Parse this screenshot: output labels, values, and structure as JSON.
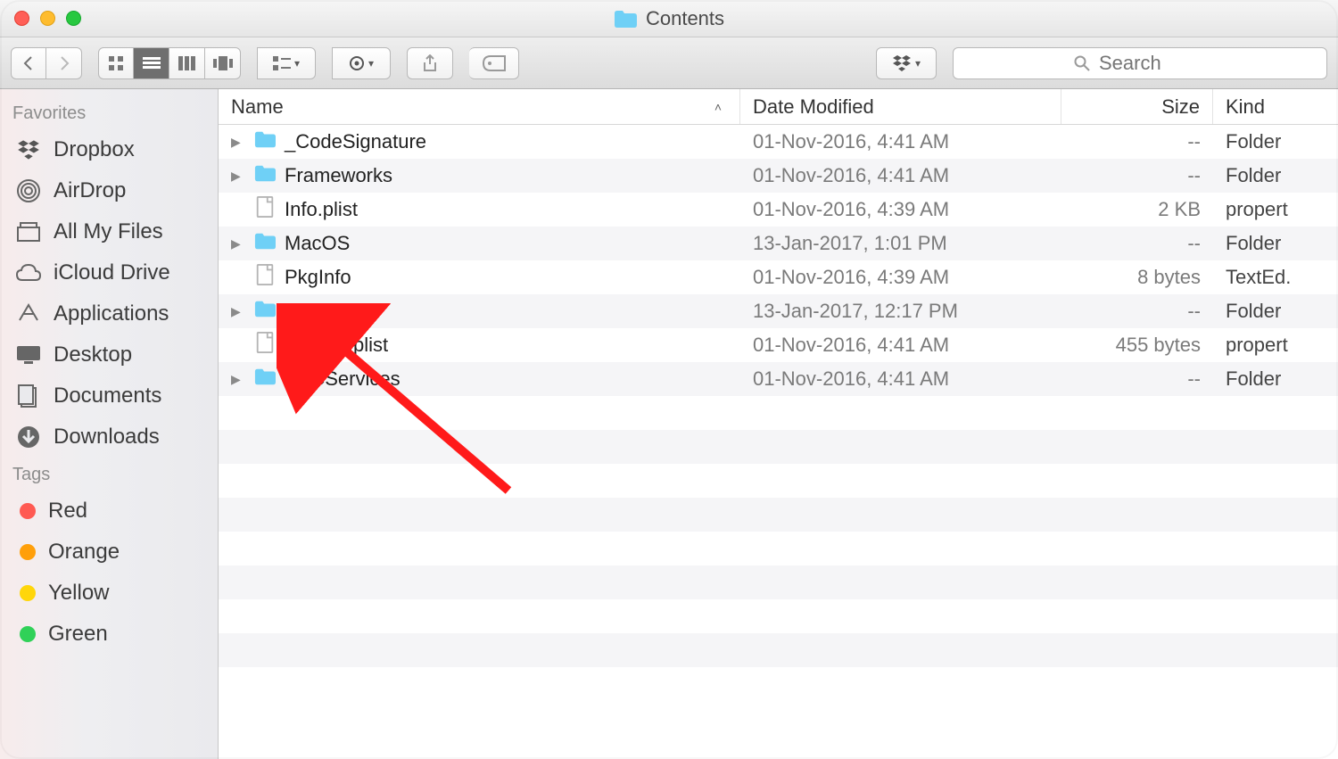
{
  "window": {
    "title": "Contents"
  },
  "toolbar": {
    "search_placeholder": "Search"
  },
  "sidebar": {
    "sections": {
      "favorites_label": "Favorites",
      "tags_label": "Tags"
    },
    "favorites": [
      {
        "label": "Dropbox",
        "icon": "dropbox-icon"
      },
      {
        "label": "AirDrop",
        "icon": "airdrop-icon"
      },
      {
        "label": "All My Files",
        "icon": "all-my-files-icon"
      },
      {
        "label": "iCloud Drive",
        "icon": "icloud-icon"
      },
      {
        "label": "Applications",
        "icon": "applications-icon"
      },
      {
        "label": "Desktop",
        "icon": "desktop-icon"
      },
      {
        "label": "Documents",
        "icon": "documents-icon"
      },
      {
        "label": "Downloads",
        "icon": "downloads-icon"
      }
    ],
    "tags": [
      {
        "label": "Red",
        "color": "#ff5a52"
      },
      {
        "label": "Orange",
        "color": "#ff9f0a"
      },
      {
        "label": "Yellow",
        "color": "#ffd60a"
      },
      {
        "label": "Green",
        "color": "#30d158"
      }
    ]
  },
  "columns": {
    "name": "Name",
    "date": "Date Modified",
    "size": "Size",
    "kind": "Kind"
  },
  "files": [
    {
      "name": "_CodeSignature",
      "type": "folder",
      "expandable": true,
      "date": "01-Nov-2016, 4:41 AM",
      "size": "--",
      "kind": "Folder"
    },
    {
      "name": "Frameworks",
      "type": "folder",
      "expandable": true,
      "date": "01-Nov-2016, 4:41 AM",
      "size": "--",
      "kind": "Folder"
    },
    {
      "name": "Info.plist",
      "type": "file",
      "expandable": false,
      "date": "01-Nov-2016, 4:39 AM",
      "size": "2 KB",
      "kind": "propert"
    },
    {
      "name": "MacOS",
      "type": "folder",
      "expandable": true,
      "date": "13-Jan-2017, 1:01 PM",
      "size": "--",
      "kind": "Folder"
    },
    {
      "name": "PkgInfo",
      "type": "file",
      "expandable": false,
      "date": "01-Nov-2016, 4:39 AM",
      "size": "8 bytes",
      "kind": "TextEd."
    },
    {
      "name": "Resources",
      "type": "folder",
      "expandable": true,
      "date": "13-Jan-2017, 12:17 PM",
      "size": "--",
      "kind": "Folder"
    },
    {
      "name": "version.plist",
      "type": "file",
      "expandable": false,
      "date": "01-Nov-2016, 4:41 AM",
      "size": "455 bytes",
      "kind": "propert"
    },
    {
      "name": "XPCServices",
      "type": "folder",
      "expandable": true,
      "date": "01-Nov-2016, 4:41 AM",
      "size": "--",
      "kind": "Folder"
    }
  ],
  "annotation": {
    "target": "Resources",
    "color": "#ff1a1a"
  }
}
